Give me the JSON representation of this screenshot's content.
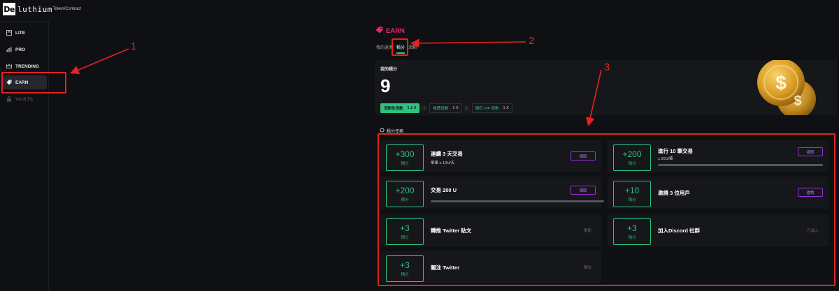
{
  "header": {
    "logo_mark": "De",
    "logo_text": "luthium",
    "breadcrumb": "› Token/Contract"
  },
  "sidebar": {
    "items": [
      {
        "label": "LITE",
        "icon": "lite-icon",
        "state": "normal"
      },
      {
        "label": "PRO",
        "icon": "pro-chart-icon",
        "state": "normal"
      },
      {
        "label": "TRENDING",
        "icon": "crown-icon",
        "state": "normal"
      },
      {
        "label": "EARN",
        "icon": "tag-icon",
        "state": "active"
      },
      {
        "label": "VAULTS",
        "icon": "lock-icon",
        "state": "disabled"
      }
    ]
  },
  "main": {
    "title": "EARN",
    "tabs": [
      {
        "label": "我的返佣",
        "active": false
      },
      {
        "label": "積分",
        "active": true
      },
      {
        "label": "活動",
        "active": false
      }
    ],
    "score": {
      "title": "我的積分",
      "value": "9",
      "multipliers": [
        {
          "label": "流動性倍數",
          "value": "1.1 X",
          "on": true
        },
        {
          "label": "推薦倍數",
          "value": "1 X",
          "on": false
        },
        {
          "label": "鑽石 VIP 倍數",
          "value": "1 X",
          "on": false
        }
      ]
    },
    "tasks_title": "積分任務",
    "tasks": [
      {
        "points": "+300",
        "unit": "積分",
        "title": "連續 3 天交易",
        "subtitle": "單筆 ≥ 10U/天",
        "action": "領取",
        "action_type": "button",
        "progress": null
      },
      {
        "points": "+200",
        "unit": "積分",
        "title": "進行 10 筆交易",
        "subtitle": "≥ 20U/筆",
        "action": "領取",
        "action_type": "button",
        "progress": 0
      },
      {
        "points": "+200",
        "unit": "積分",
        "title": "交易 200 U",
        "subtitle": "",
        "action": "領取",
        "action_type": "button",
        "progress": 0
      },
      {
        "points": "+10",
        "unit": "積分",
        "title": "邀請 3 位用戶",
        "subtitle": "",
        "action": "邀請",
        "action_type": "button",
        "progress": null
      },
      {
        "points": "+3",
        "unit": "積分",
        "title": "轉推 Twitter 貼文",
        "subtitle": "",
        "action": "重新",
        "action_type": "text",
        "progress": null
      },
      {
        "points": "+3",
        "unit": "積分",
        "title": "加入Discord 社群",
        "subtitle": "",
        "action": "已加入",
        "action_type": "text",
        "progress": null
      },
      {
        "points": "+3",
        "unit": "積分",
        "title": "關注 Twitter",
        "subtitle": "",
        "action": "關注",
        "action_type": "text",
        "progress": null
      }
    ]
  },
  "annotations": {
    "labels": [
      "1",
      "2",
      "3"
    ],
    "color": "#e52222"
  },
  "colors": {
    "accent_green": "#2ec27e",
    "accent_pink": "#e8286f",
    "accent_purple": "#9b30d9",
    "background": "#0f1013",
    "card": "#16171b"
  }
}
